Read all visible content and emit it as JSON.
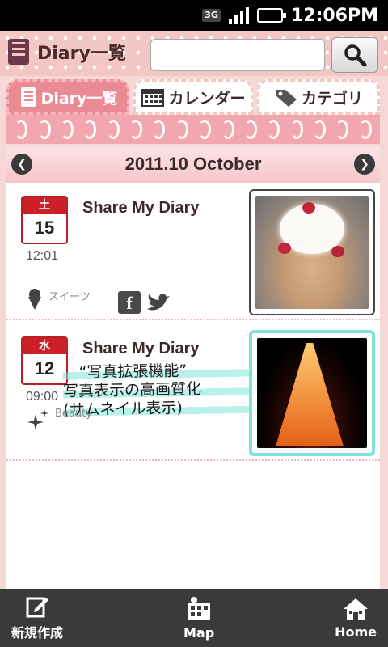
{
  "status_bar": {
    "network": "3G",
    "time": "12:06PM"
  },
  "header": {
    "title": "Diary一覧",
    "search": {
      "value": "",
      "placeholder": ""
    }
  },
  "tabs": [
    {
      "label": "Diary一覧",
      "icon": "notebook-icon",
      "active": true
    },
    {
      "label": "カレンダー",
      "icon": "calendar-icon",
      "active": false
    },
    {
      "label": "カテゴリ",
      "icon": "tag-icon",
      "active": false
    }
  ],
  "month_nav": {
    "label": "2011.10 October"
  },
  "entries": [
    {
      "weekday": "土",
      "day": "15",
      "time": "12:01",
      "title": "Share My Diary",
      "category": "スイーツ",
      "category_icon": "ice-cream-icon",
      "shared_to": [
        "facebook-icon",
        "twitter-icon"
      ],
      "photo": "pancake-photo"
    },
    {
      "weekday": "水",
      "day": "12",
      "time": "09:00",
      "title": "Share My Diary",
      "category": "Beauty",
      "category_icon": "sparkle-icon",
      "photo": "tokyo-tower-photo"
    }
  ],
  "annotation": {
    "line1": "“写真拡張機能”",
    "line2": "写真表示の高画質化",
    "line3": "(サムネイル表示)"
  },
  "bottom_bar": {
    "new_label": "新規作成",
    "map_label": "Map",
    "home_label": "Home"
  },
  "colors": {
    "accent_pink": "#ea8a93",
    "date_red": "#cc1f27",
    "highlight_teal": "#7ee4d8"
  }
}
